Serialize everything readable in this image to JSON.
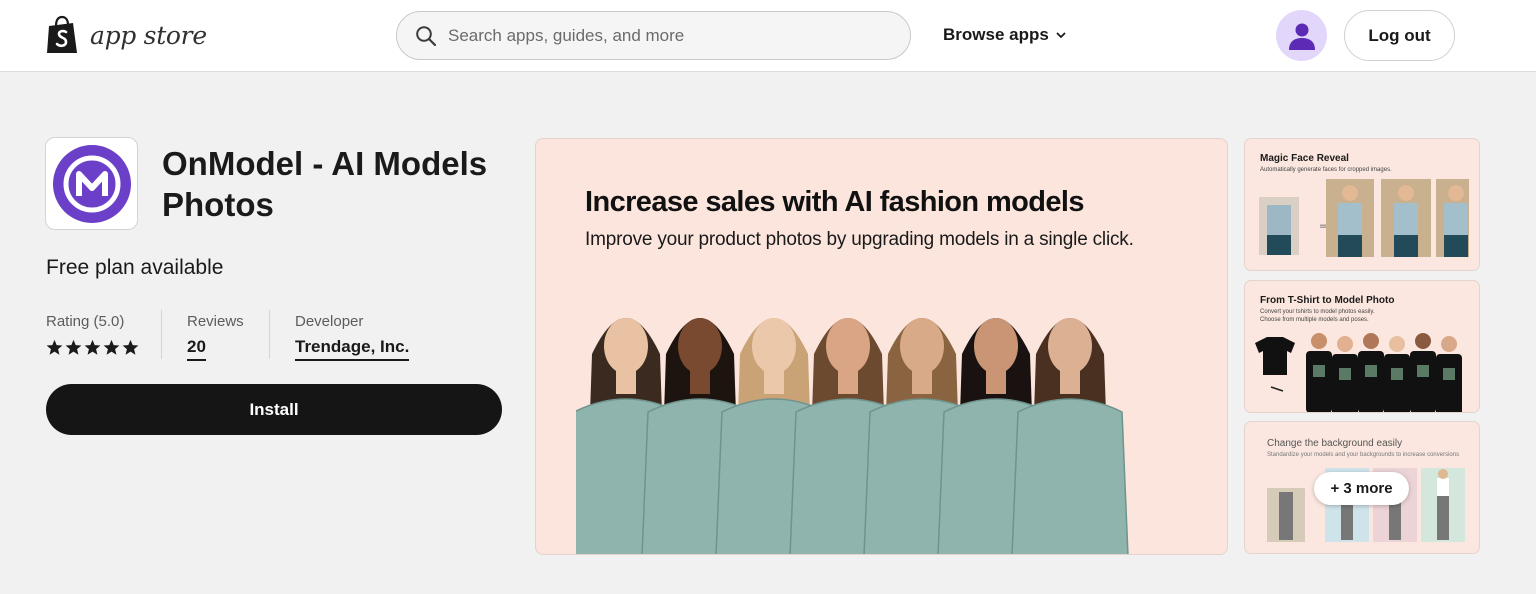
{
  "header": {
    "logo_text": "app store",
    "search_placeholder": "Search apps, guides, and more",
    "browse_label": "Browse apps",
    "logout_label": "Log out"
  },
  "app": {
    "title": "OnModel - AI Models Photos",
    "free_plan": "Free plan available",
    "rating_label": "Rating (5.0)",
    "rating_value": 5,
    "reviews_label": "Reviews",
    "reviews_count": "20",
    "developer_label": "Developer",
    "developer_name": "Trendage, Inc.",
    "install_label": "Install"
  },
  "hero": {
    "title": "Increase sales with AI fashion models",
    "subtitle": "Improve your product photos by upgrading models in a single click."
  },
  "thumbnails": [
    {
      "title": "Magic Face Reveal",
      "subtitle": "Automatically generate faces for cropped images."
    },
    {
      "title": "From T-Shirt to Model Photo",
      "subtitle": "Convert your tshirts to model photos easily. Choose from multiple models and poses."
    },
    {
      "title": "Change the background easily",
      "subtitle": "Standardize your models and your backgrounds to increase conversions"
    }
  ],
  "more_label": "+ 3 more",
  "colors": {
    "accent_dark": "#151515",
    "avatar_bg": "#e2d6fb",
    "avatar_fg": "#5b2bb5",
    "app_icon": "#6b3fc8",
    "hero_bg": "#fbe5dd"
  }
}
